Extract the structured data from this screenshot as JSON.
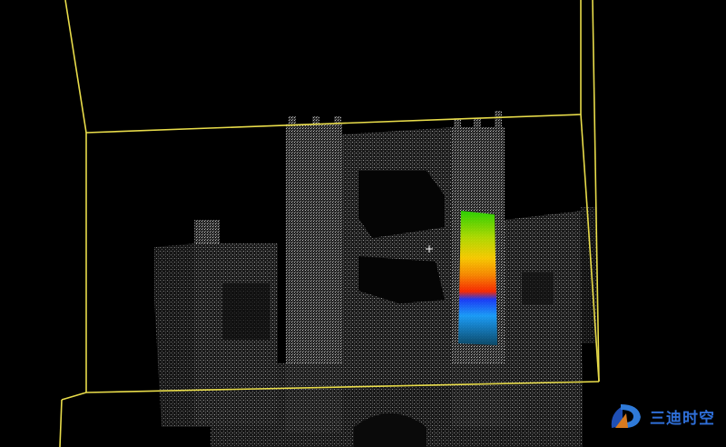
{
  "viewer": {
    "background": "#000000",
    "bounding_box_color": "#e8dc4a",
    "point_color": "#cfcfcf",
    "highlight_colors": [
      "#00c8ff",
      "#1a3cff",
      "#ff2a00",
      "#ff9a00",
      "#c8e000",
      "#38d000"
    ]
  },
  "watermark": {
    "icon": "logo-icon",
    "text": "三迪时空"
  }
}
